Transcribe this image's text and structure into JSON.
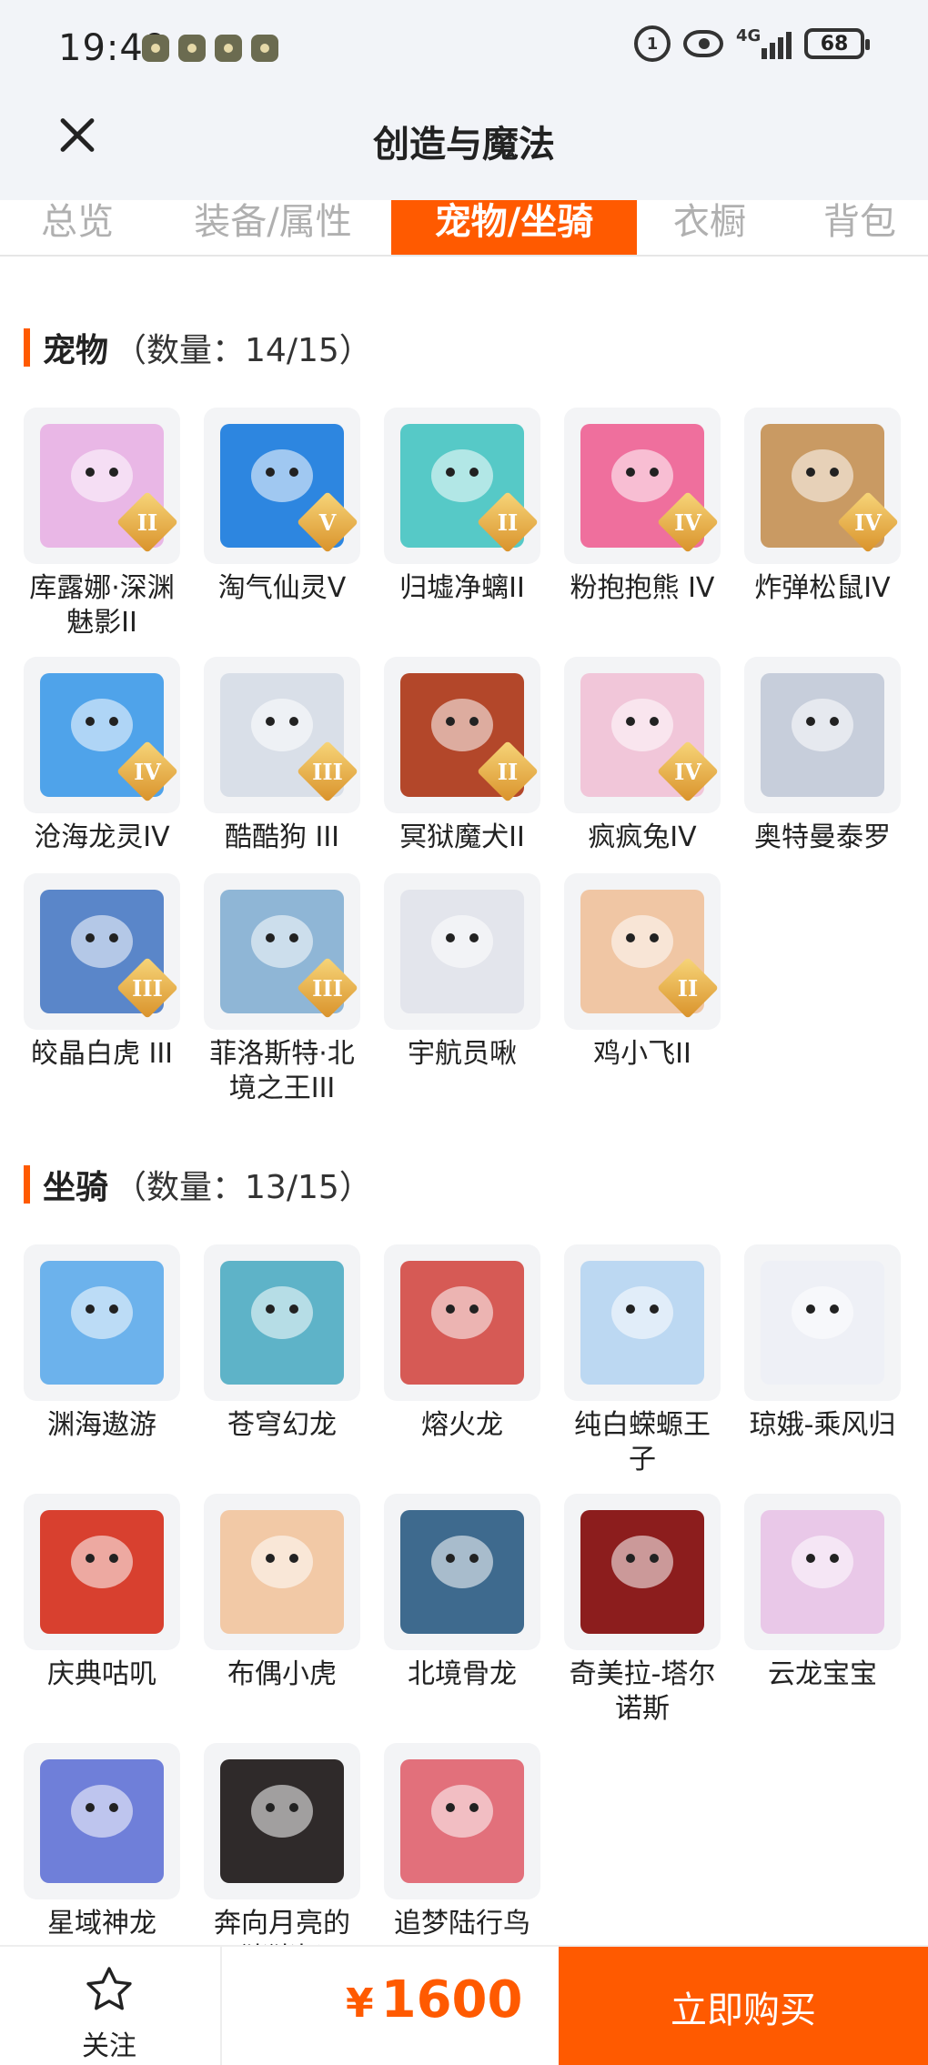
{
  "status_bar": {
    "time": "19:49",
    "battery": "68",
    "network": "4G"
  },
  "header": {
    "title": "创造与魔法"
  },
  "tabs": [
    {
      "label": "总览"
    },
    {
      "label": "装备/属性"
    },
    {
      "label": "宠物/坐骑"
    },
    {
      "label": "衣橱"
    },
    {
      "label": "背包"
    }
  ],
  "pets": {
    "title": "宠物",
    "count": "（数量：14/15）",
    "items": [
      {
        "name": "库露娜·深渊魅影II",
        "rank": "II",
        "color": "#e9b7e6"
      },
      {
        "name": "淘气仙灵V",
        "rank": "V",
        "color": "#2d86e0"
      },
      {
        "name": "归墟净螭II",
        "rank": "II",
        "color": "#56c9c7"
      },
      {
        "name": "粉抱抱熊 IV",
        "rank": "IV",
        "color": "#ef6f9d"
      },
      {
        "name": "炸弹松鼠IV",
        "rank": "IV",
        "color": "#c99a63"
      },
      {
        "name": "沧海龙灵IV",
        "rank": "IV",
        "color": "#4fa3ea"
      },
      {
        "name": "酷酷狗 III",
        "rank": "III",
        "color": "#d9dfe8"
      },
      {
        "name": "冥狱魔犬II",
        "rank": "II",
        "color": "#b3472a"
      },
      {
        "name": "疯疯兔IV",
        "rank": "IV",
        "color": "#f1c6d9"
      },
      {
        "name": "奥特曼泰罗",
        "rank": "",
        "color": "#c7cedb"
      },
      {
        "name": "皎晶白虎 III",
        "rank": "III",
        "color": "#5a86c9"
      },
      {
        "name": "菲洛斯特·北境之王III",
        "rank": "III",
        "color": "#8fb6d6"
      },
      {
        "name": "宇航员啾",
        "rank": "",
        "color": "#e3e5ec"
      },
      {
        "name": "鸡小飞II",
        "rank": "II",
        "color": "#f0c6a4"
      }
    ]
  },
  "mounts": {
    "title": "坐骑",
    "count": "（数量：13/15）",
    "items": [
      {
        "name": "渊海遨游",
        "color": "#6cb2ec"
      },
      {
        "name": "苍穹幻龙",
        "color": "#5eb3c8"
      },
      {
        "name": "熔火龙",
        "color": "#d65a55"
      },
      {
        "name": "纯白蝾螈王子",
        "color": "#bcd8f2"
      },
      {
        "name": "琼娥-乘风归",
        "color": "#eef0f6"
      },
      {
        "name": "庆典咕叽",
        "color": "#d8402f"
      },
      {
        "name": "布偶小虎",
        "color": "#f2c9a6"
      },
      {
        "name": "北境骨龙",
        "color": "#3e6a8e"
      },
      {
        "name": "奇美拉-塔尔诺斯",
        "color": "#8c1d1d"
      },
      {
        "name": "云龙宝宝",
        "color": "#e9c8e8"
      },
      {
        "name": "星域神龙",
        "color": "#6f7fd9"
      },
      {
        "name": "奔向月亮的猪猪怪",
        "color": "#2f2a2a"
      },
      {
        "name": "追梦陆行鸟",
        "color": "#e2707b"
      }
    ]
  },
  "bottom": {
    "favorite_label": "关注",
    "currency": "¥",
    "price": "1600",
    "buy_label": "立即购买"
  },
  "colors": {
    "accent": "#ff5a00",
    "header_bg": "#f2f4f8"
  }
}
